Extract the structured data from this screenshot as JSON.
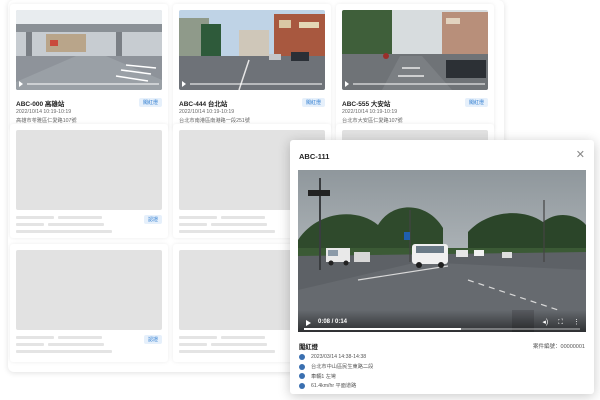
{
  "cards": [
    {
      "title": "ABC-000 高雄站",
      "badge": "闖紅燈",
      "time": "2022/10/14 10:19-10:19",
      "address": "高雄市苓雅區仁愛路107號",
      "thumb": "overpass-road"
    },
    {
      "title": "ABC-444 台北站",
      "badge": "闖紅燈",
      "time": "2022/10/14 10:19-10:19",
      "address": "台北市南港區南港路一段251號",
      "thumb": "city-street"
    },
    {
      "title": "ABC-555 大安站",
      "badge": "闖紅燈",
      "time": "2022/10/14 10:19-10:19",
      "address": "台北市大安區仁愛路107號",
      "thumb": "scooter-street"
    }
  ],
  "placeholder_badges": [
    "認證",
    "認證"
  ],
  "modal": {
    "title": "ABC-111",
    "close_icon": "close-icon",
    "video": {
      "time": "0:08 / 0:14",
      "progress": 0.57
    },
    "violation_type": "闖紅燈",
    "case_number": "案件編號：00000001",
    "details": [
      {
        "icon": "clock-icon",
        "text": "2023/03/14 14:38-14:38"
      },
      {
        "icon": "location-icon",
        "text": "台北市中山區民生東路二段"
      },
      {
        "icon": "car-icon",
        "text": "車輛1 左彎"
      },
      {
        "icon": "speed-icon",
        "text": "61.4km/hr 平面道路"
      }
    ]
  },
  "colors": {
    "accent": "#2f7dd1",
    "badge_bg": "#e6f0fb",
    "placeholder": "#e2e2e2"
  }
}
